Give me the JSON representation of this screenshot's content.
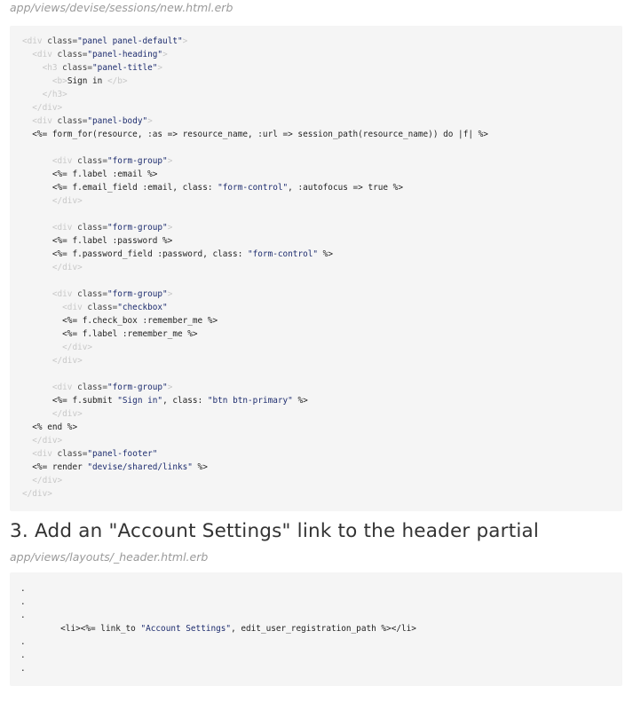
{
  "section2": {
    "file_path": "app/views/devise/sessions/new.html.erb",
    "code_lines": [
      [
        [
          "tag",
          "<div "
        ],
        [
          "attr",
          "class="
        ],
        [
          "str",
          "\"panel panel-default\""
        ],
        [
          "tag",
          ">"
        ]
      ],
      [
        [
          "tag",
          "  <div "
        ],
        [
          "attr",
          "class="
        ],
        [
          "str",
          "\"panel-heading\""
        ],
        [
          "tag",
          ">"
        ]
      ],
      [
        [
          "tag",
          "    <h3 "
        ],
        [
          "attr",
          "class="
        ],
        [
          "str",
          "\"panel-title\""
        ],
        [
          "tag",
          ">"
        ]
      ],
      [
        [
          "tag",
          "      <b>"
        ],
        [
          "erb",
          "Sign in"
        ],
        [
          "tag",
          " </b>"
        ]
      ],
      [
        [
          "tag",
          "    </h3>"
        ]
      ],
      [
        [
          "tag",
          "  </div>"
        ]
      ],
      [
        [
          "tag",
          "  <div "
        ],
        [
          "attr",
          "class="
        ],
        [
          "str",
          "\"panel-body\""
        ],
        [
          "tag",
          ">"
        ]
      ],
      [
        [
          "erb",
          "  <%= form_for(resource, :as => resource_name, :url => session_path(resource_name)) do |f| %>"
        ]
      ],
      [],
      [
        [
          "tag",
          "      <div "
        ],
        [
          "attr",
          "class="
        ],
        [
          "str",
          "\"form-group\""
        ],
        [
          "tag",
          ">"
        ]
      ],
      [
        [
          "erb",
          "      <%= f.label :email %>"
        ]
      ],
      [
        [
          "erb",
          "      <%= f.email_field :email, class: "
        ],
        [
          "str",
          "\"form-control\""
        ],
        [
          "erb",
          ", :autofocus => true %>"
        ]
      ],
      [
        [
          "tag",
          "      </div>"
        ]
      ],
      [],
      [
        [
          "tag",
          "      <div "
        ],
        [
          "attr",
          "class="
        ],
        [
          "str",
          "\"form-group\""
        ],
        [
          "tag",
          ">"
        ]
      ],
      [
        [
          "erb",
          "      <%= f.label :password %>"
        ]
      ],
      [
        [
          "erb",
          "      <%= f.password_field :password, class: "
        ],
        [
          "str",
          "\"form-control\""
        ],
        [
          "erb",
          " %>"
        ]
      ],
      [
        [
          "tag",
          "      </div>"
        ]
      ],
      [],
      [
        [
          "tag",
          "      <div "
        ],
        [
          "attr",
          "class="
        ],
        [
          "str",
          "\"form-group\""
        ],
        [
          "tag",
          ">"
        ]
      ],
      [
        [
          "tag",
          "        <div "
        ],
        [
          "attr",
          "class="
        ],
        [
          "str",
          "\"checkbox\""
        ]
      ],
      [
        [
          "erb",
          "        <%= f.check_box :remember_me %>"
        ]
      ],
      [
        [
          "erb",
          "        <%= f.label :remember_me %>"
        ]
      ],
      [
        [
          "tag",
          "        </div>"
        ]
      ],
      [
        [
          "tag",
          "      </div>"
        ]
      ],
      [],
      [
        [
          "tag",
          "      <div "
        ],
        [
          "attr",
          "class="
        ],
        [
          "str",
          "\"form-group\""
        ],
        [
          "tag",
          ">"
        ]
      ],
      [
        [
          "erb",
          "      <%= f.submit "
        ],
        [
          "str",
          "\"Sign in\""
        ],
        [
          "erb",
          ", class: "
        ],
        [
          "str",
          "\"btn btn-primary\""
        ],
        [
          "erb",
          " %>"
        ]
      ],
      [
        [
          "tag",
          "      </div>"
        ]
      ],
      [
        [
          "erb",
          "  <% end %>"
        ]
      ],
      [
        [
          "tag",
          "  </div>"
        ]
      ],
      [
        [
          "tag",
          "  <div "
        ],
        [
          "attr",
          "class="
        ],
        [
          "str",
          "\"panel-footer\""
        ]
      ],
      [
        [
          "erb",
          "  <%= render "
        ],
        [
          "str",
          "\"devise/shared/links\""
        ],
        [
          "erb",
          " %>"
        ]
      ],
      [
        [
          "tag",
          "  </div>"
        ]
      ],
      [
        [
          "tag",
          "</div>"
        ]
      ]
    ]
  },
  "section3": {
    "heading": "3. Add an \"Account Settings\" link to the header partial",
    "file_path": "app/views/layouts/_header.html.erb",
    "code_lines": [
      [
        [
          "erb",
          "."
        ]
      ],
      [
        [
          "erb",
          "."
        ]
      ],
      [
        [
          "erb",
          "."
        ]
      ],
      [
        [
          "erb",
          "        <li><%= link_to "
        ],
        [
          "str",
          "\"Account Settings\""
        ],
        [
          "erb",
          ", edit_user_registration_path %></li>"
        ]
      ],
      [
        [
          "erb",
          "."
        ]
      ],
      [
        [
          "erb",
          "."
        ]
      ],
      [
        [
          "erb",
          "."
        ]
      ]
    ]
  }
}
